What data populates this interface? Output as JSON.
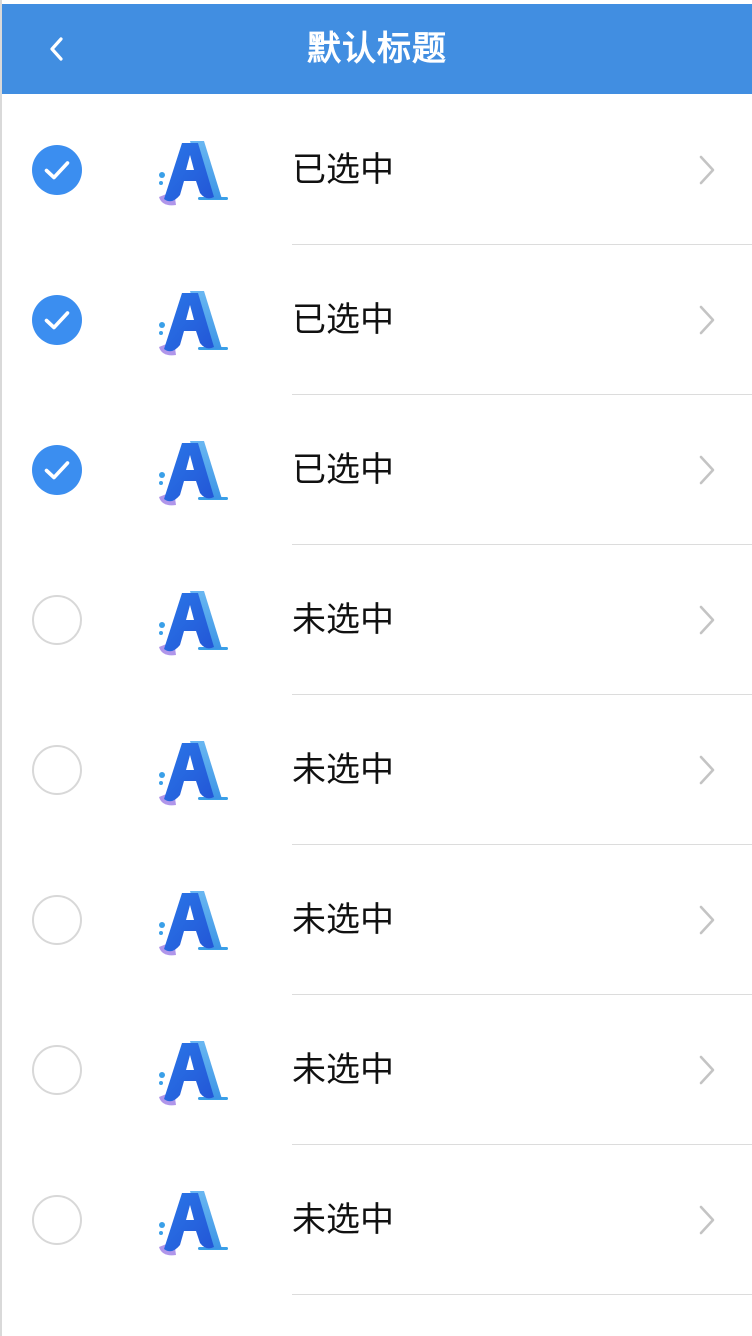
{
  "header": {
    "title": "默认标题",
    "back_icon": "chevron-left-icon"
  },
  "colors": {
    "accent": "#418ee1",
    "check": "#3b8ef0",
    "divider": "#dcdcdc",
    "chevron": "#c4c4c4"
  },
  "list": {
    "items": [
      {
        "label": "已选中",
        "checked": true
      },
      {
        "label": "已选中",
        "checked": true
      },
      {
        "label": "已选中",
        "checked": true
      },
      {
        "label": "未选中",
        "checked": false
      },
      {
        "label": "未选中",
        "checked": false
      },
      {
        "label": "未选中",
        "checked": false
      },
      {
        "label": "未选中",
        "checked": false
      },
      {
        "label": "未选中",
        "checked": false
      }
    ]
  }
}
